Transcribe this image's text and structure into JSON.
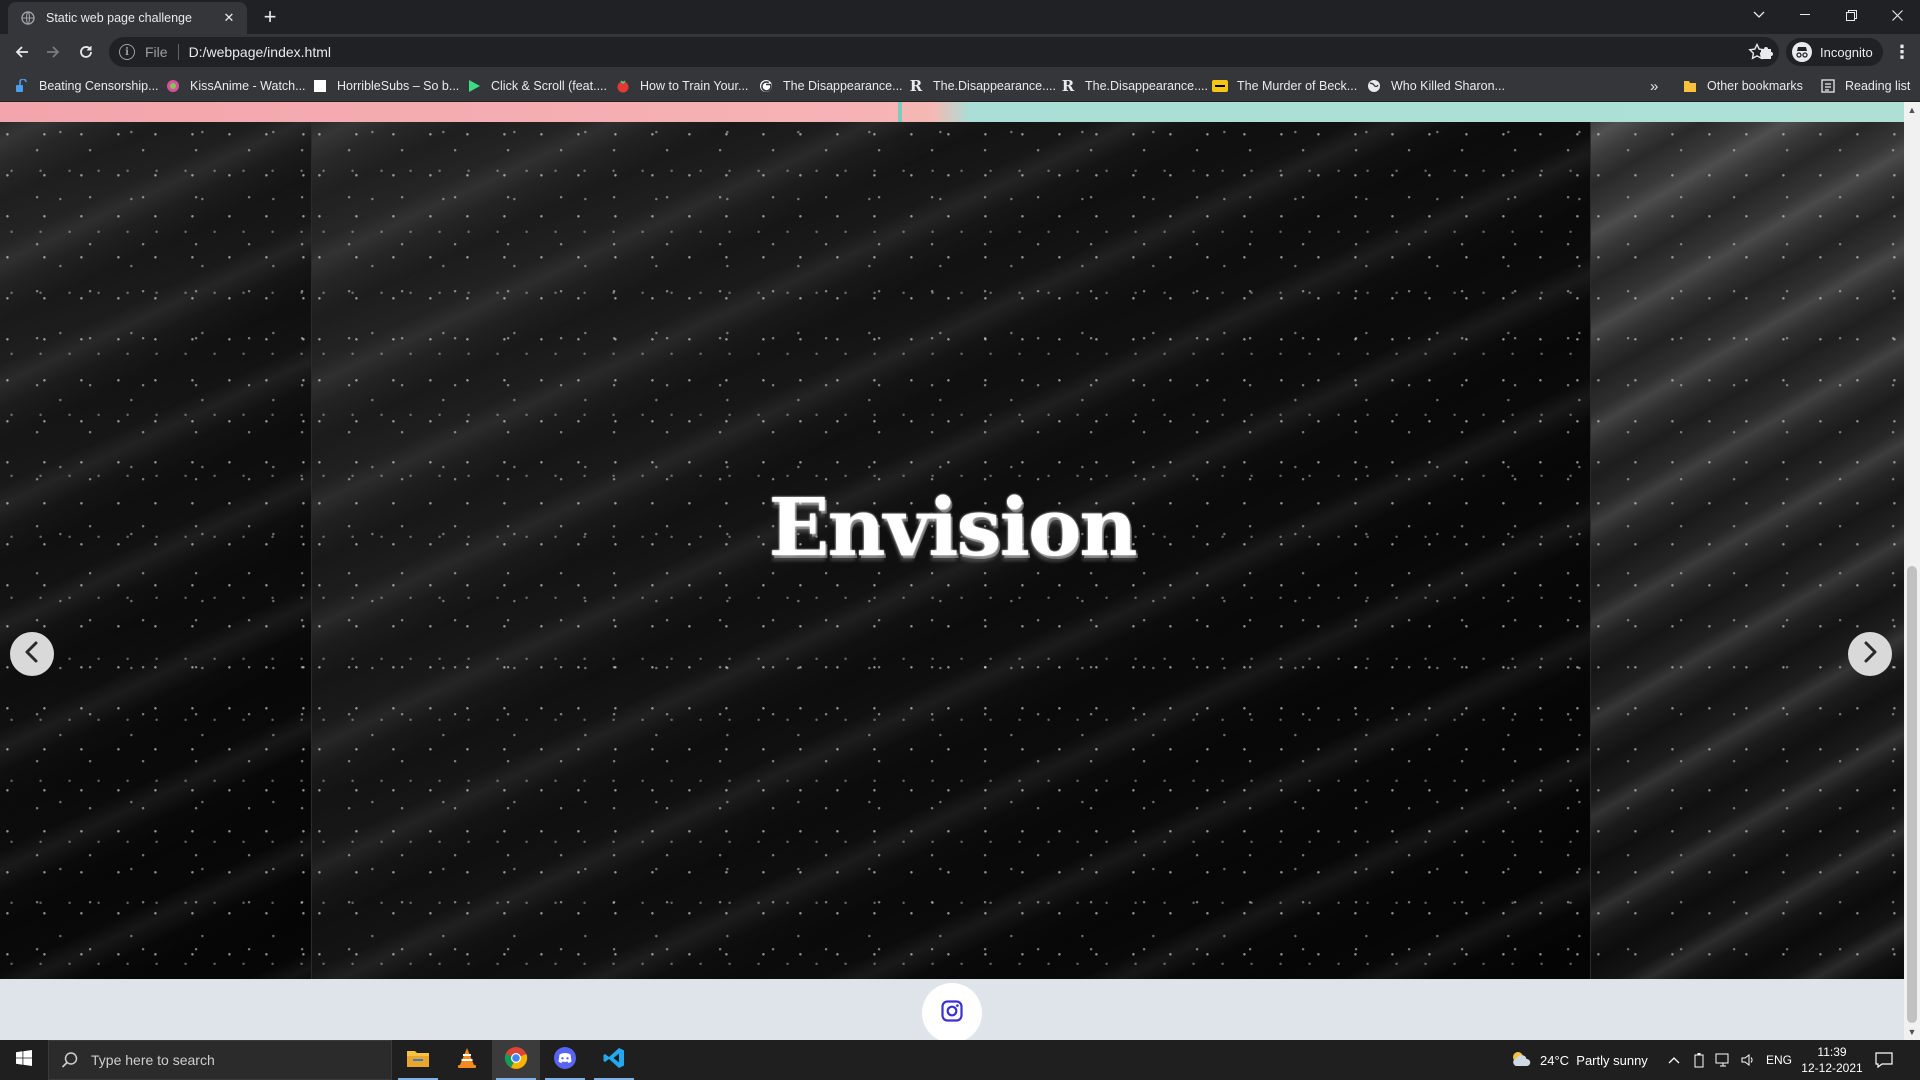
{
  "browser": {
    "tab_title": "Static web page challenge",
    "tab_close": "✕",
    "new_tab": "+",
    "window_controls": {
      "dropdown": "⌄",
      "minimize": "—",
      "restore": "❐",
      "close": "✕"
    },
    "omnibox": {
      "scheme": "File",
      "url": "D:/webpage/index.html"
    },
    "profile_label": "Incognito",
    "menu": "⋮"
  },
  "bookmarks": {
    "items": [
      {
        "label": "Beating Censorship...",
        "icon": "censorship-favicon",
        "color": "#4a9eed"
      },
      {
        "label": "KissAnime - Watch...",
        "icon": "kissanime-favicon",
        "color": "#d94f9b"
      },
      {
        "label": "HorribleSubs – So b...",
        "icon": "horriblesubs-favicon",
        "color": "#ffffff"
      },
      {
        "label": "Click & Scroll (feat....",
        "icon": "play-favicon",
        "color": "#3ddc84"
      },
      {
        "label": "How to Train Your...",
        "icon": "tomato-favicon",
        "color": "#e53935"
      },
      {
        "label": "The Disappearance...",
        "icon": "google-favicon",
        "color": "#ffffff"
      },
      {
        "label": "The.Disappearance....",
        "icon": "r-favicon",
        "color": "#e8eaed"
      },
      {
        "label": "The.Disappearance....",
        "icon": "r-favicon",
        "color": "#e8eaed"
      },
      {
        "label": "The Murder of Beck...",
        "icon": "imdb-favicon",
        "color": "#f5c518"
      },
      {
        "label": "Who Killed Sharon...",
        "icon": "globe-favicon",
        "color": "#e8eaed"
      }
    ],
    "overflow": "»",
    "other_bookmarks": "Other bookmarks",
    "reading_list": "Reading list"
  },
  "page": {
    "slide_title": "Envision",
    "prev_icon": "chevron-left-icon",
    "next_icon": "chevron-right-icon",
    "social_icon": "instagram-icon",
    "accent_colors": {
      "pink": "#f6b3b6",
      "teal": "#aee0d6",
      "instagram": "#3b2fd6"
    }
  },
  "taskbar": {
    "search_placeholder": "Type here to search",
    "weather": "24°C  Partly sunny",
    "language": "ENG",
    "time": "11:39",
    "date": "12-12-2021"
  }
}
